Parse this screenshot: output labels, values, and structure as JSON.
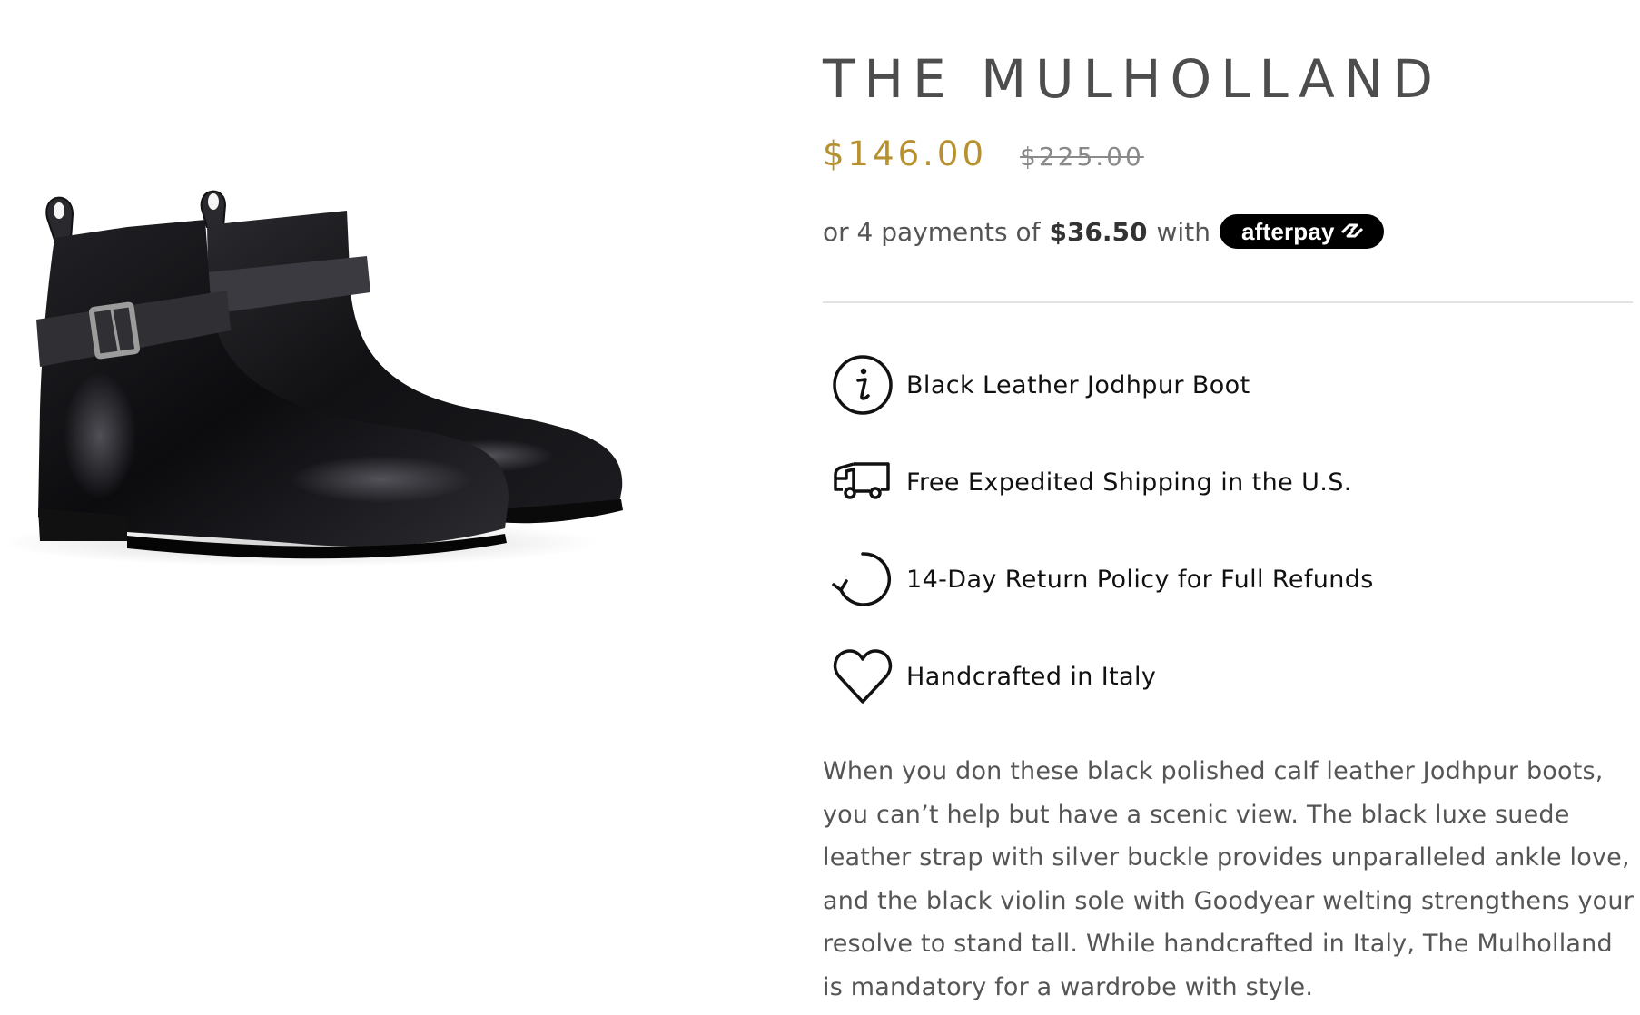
{
  "product": {
    "title": "THE MULHOLLAND",
    "image_alt": "Black leather Jodhpur boots with suede strap and silver buckle",
    "price": {
      "sale": "$146.00",
      "original": "$225.00",
      "sale_color": "#b8912f"
    },
    "installments": {
      "prefix": "or 4 payments of",
      "amount": "$36.50",
      "suffix": "with",
      "provider": "afterpay",
      "provider_icon": "afterpay-loop-icon"
    },
    "features": [
      {
        "icon": "info-icon",
        "text": "Black Leather Jodhpur Boot"
      },
      {
        "icon": "truck-icon",
        "text": "Free Expedited Shipping in the U.S."
      },
      {
        "icon": "return-arrow-icon",
        "text": "14-Day Return Policy for Full Refunds"
      },
      {
        "icon": "heart-icon",
        "text": "Handcrafted in Italy"
      }
    ],
    "description": "When you don these black polished calf leather Jodhpur boots, you can’t help but have a scenic view. The black luxe suede leather strap with silver buckle provides unparalleled ankle love, and the black violin sole with Goodyear welting strengthens your resolve to stand tall. While handcrafted in Italy, The Mulholland is mandatory for a wardrobe with style."
  }
}
